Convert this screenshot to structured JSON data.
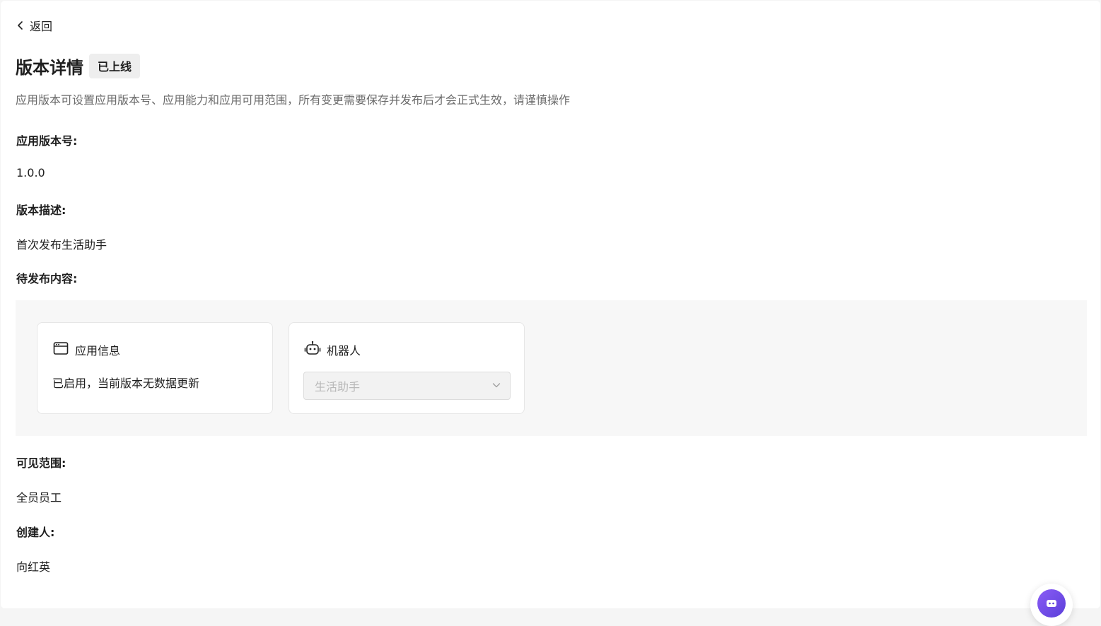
{
  "nav": {
    "back_label": "返回"
  },
  "header": {
    "title": "版本详情",
    "status_badge": "已上线"
  },
  "description": "应用版本可设置应用版本号、应用能力和应用可用范围，所有变更需要保存并发布后才会正式生效，请谨慎操作",
  "fields": {
    "version_number": {
      "label": "应用版本号:",
      "value": "1.0.0"
    },
    "version_desc": {
      "label": "版本描述:",
      "value": "首次发布生活助手"
    },
    "pending_content": {
      "label": "待发布内容:"
    },
    "visibility": {
      "label": "可见范围:",
      "value": "全员员工"
    },
    "creator": {
      "label": "创建人:",
      "value": "向红英"
    }
  },
  "cards": {
    "app_info": {
      "title": "应用信息",
      "icon": "app-window-icon",
      "text": "已启用，当前版本无数据更新"
    },
    "robot": {
      "title": "机器人",
      "icon": "robot-icon",
      "select_value": "生活助手"
    }
  },
  "colors": {
    "accent": "#6b46e5",
    "muted_text": "#6b6b6b",
    "panel_bg": "#f7f7f7"
  }
}
